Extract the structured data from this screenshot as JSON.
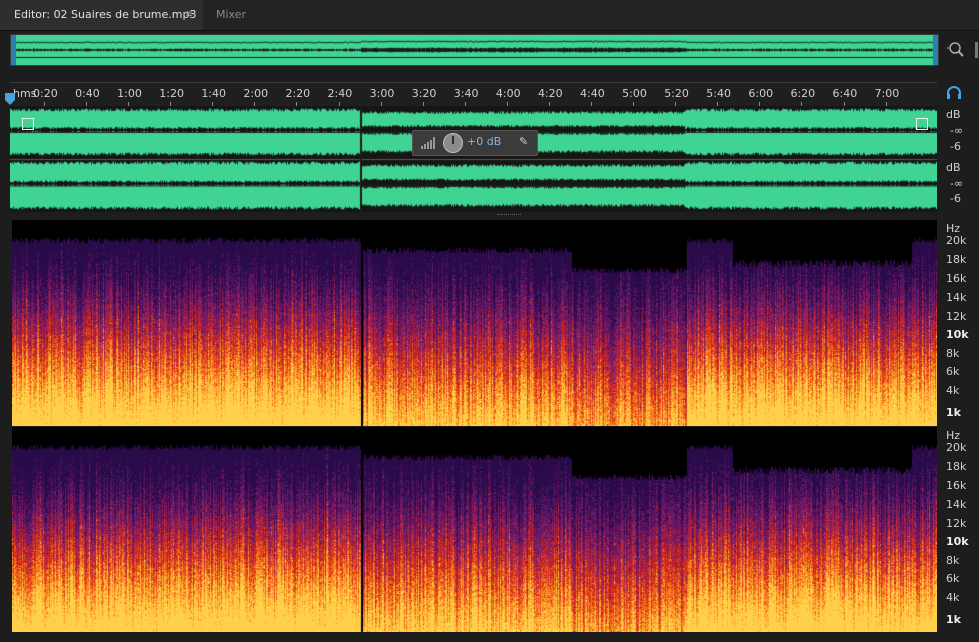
{
  "tabs": {
    "editor_label": "Editor: 02 Suaires de brume.mp3",
    "editor_menu": "≡",
    "mixer_label": "Mixer"
  },
  "ruler": {
    "unit": "hms",
    "ticks": [
      "0:20",
      "0:40",
      "1:00",
      "1:20",
      "1:40",
      "2:00",
      "2:20",
      "2:40",
      "3:00",
      "3:20",
      "3:40",
      "4:00",
      "4:20",
      "4:40",
      "5:00",
      "5:20",
      "5:40",
      "6:00",
      "6:20",
      "6:40",
      "7:00"
    ]
  },
  "hud": {
    "volume": "+0 dB",
    "pin_glyph": "✎"
  },
  "waveform_scale": {
    "db": "dB",
    "neg_inf": "-∞",
    "minus6": "-6"
  },
  "spectral_scale": {
    "unit": "Hz",
    "labels": [
      "20k",
      "18k",
      "16k",
      "14k",
      "12k",
      "10k",
      "8k",
      "6k",
      "4k",
      "1k"
    ]
  },
  "colors": {
    "waveform": "#3fd494",
    "accent": "#2b7fb3",
    "spectrum_low": "#2a0b4a",
    "spectrum_mid": "#d42a1a",
    "spectrum_high": "#ffd04a"
  }
}
